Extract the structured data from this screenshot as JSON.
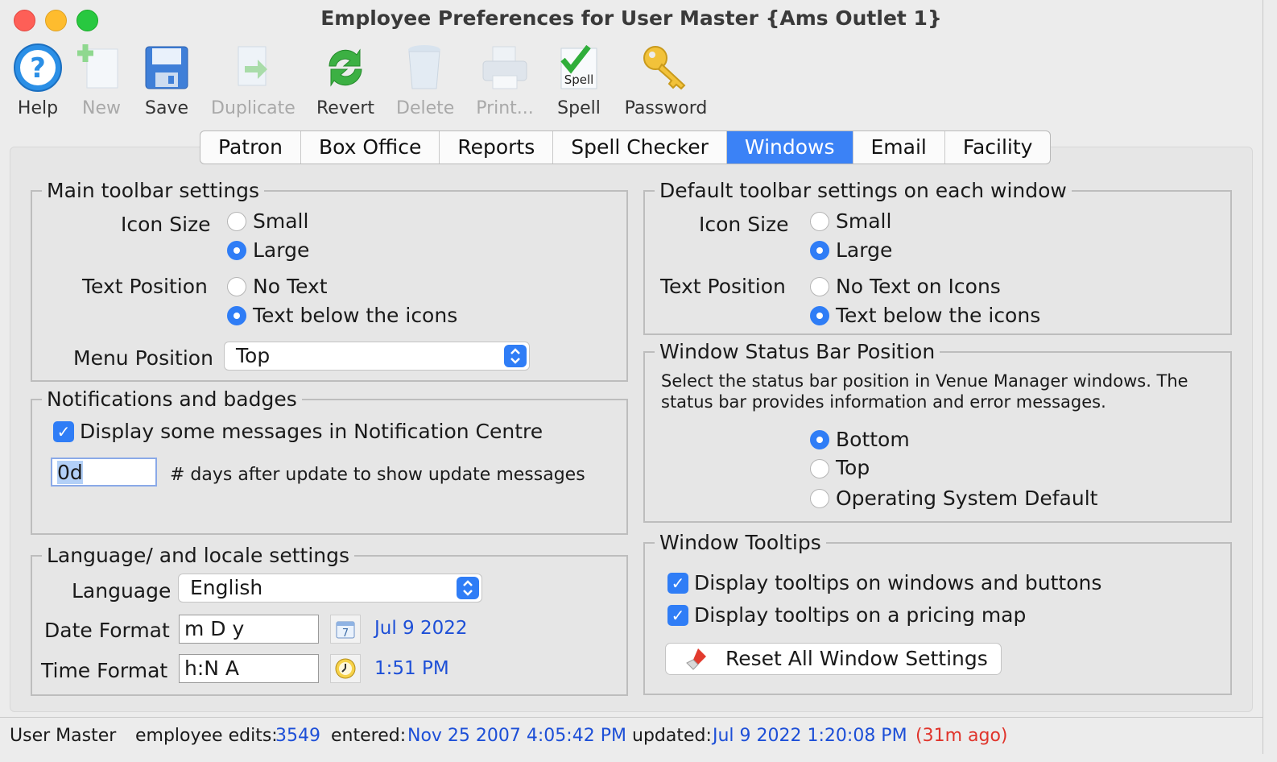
{
  "window": {
    "title": "Employee Preferences for User Master {Ams Outlet 1}"
  },
  "toolbar": {
    "help": "Help",
    "new": "New",
    "save": "Save",
    "duplicate": "Duplicate",
    "revert": "Revert",
    "delete": "Delete",
    "print": "Print...",
    "spell": "Spell",
    "password": "Password",
    "spell_icon_text": "Spell"
  },
  "tabs": [
    "Patron",
    "Box Office",
    "Reports",
    "Spell Checker",
    "Windows",
    "Email",
    "Facility"
  ],
  "active_tab": "Windows",
  "main_toolbar": {
    "title": "Main toolbar settings",
    "icon_size_label": "Icon Size",
    "small": "Small",
    "large": "Large",
    "text_position_label": "Text Position",
    "no_text": "No Text",
    "text_below": "Text below the icons",
    "menu_position_label": "Menu Position",
    "menu_position_value": "Top"
  },
  "notifications": {
    "title": "Notifications and badges",
    "display_messages": "Display some messages in Notification Centre",
    "days_value": "0d",
    "days_label": "# days after update to show update messages"
  },
  "language": {
    "title": "Language/ and locale settings",
    "language_label": "Language",
    "language_value": "English",
    "date_format_label": "Date Format",
    "date_format_value": "m D y",
    "date_preview": "Jul 9 2022",
    "time_format_label": "Time Format",
    "time_format_value": "h:N A",
    "time_preview": "1:51 PM",
    "calendar_icon_text": "7"
  },
  "default_toolbar": {
    "title": "Default toolbar settings on each window",
    "icon_size_label": "Icon Size",
    "small": "Small",
    "large": "Large",
    "text_position_label": "Text Position",
    "no_text": "No Text on Icons",
    "text_below": "Text below the icons"
  },
  "status_bar_position": {
    "title": "Window Status Bar Position",
    "desc_line1": "Select the status bar position in Venue Manager windows.  The",
    "desc_line2": "status bar provides information and error messages.",
    "bottom": "Bottom",
    "top": "Top",
    "os_default": "Operating System Default"
  },
  "tooltips": {
    "title": "Window Tooltips",
    "on_windows": "Display tooltips on windows and buttons",
    "on_pricing_map": "Display tooltips on a pricing map",
    "reset_button": "Reset All Window Settings"
  },
  "status": {
    "user": "User Master",
    "edits_label": "employee edits:",
    "edits_value": "3549",
    "entered_label": "entered:",
    "entered_value": "Nov 25 2007 4:05:42 PM",
    "updated_label": "updated:",
    "updated_value": "Jul 9 2022 1:20:08 PM",
    "ago": "(31m ago)"
  },
  "colors": {
    "accent": "#2f7df6",
    "link_blue": "#1d4fd7",
    "warn_red": "#e0342b"
  }
}
